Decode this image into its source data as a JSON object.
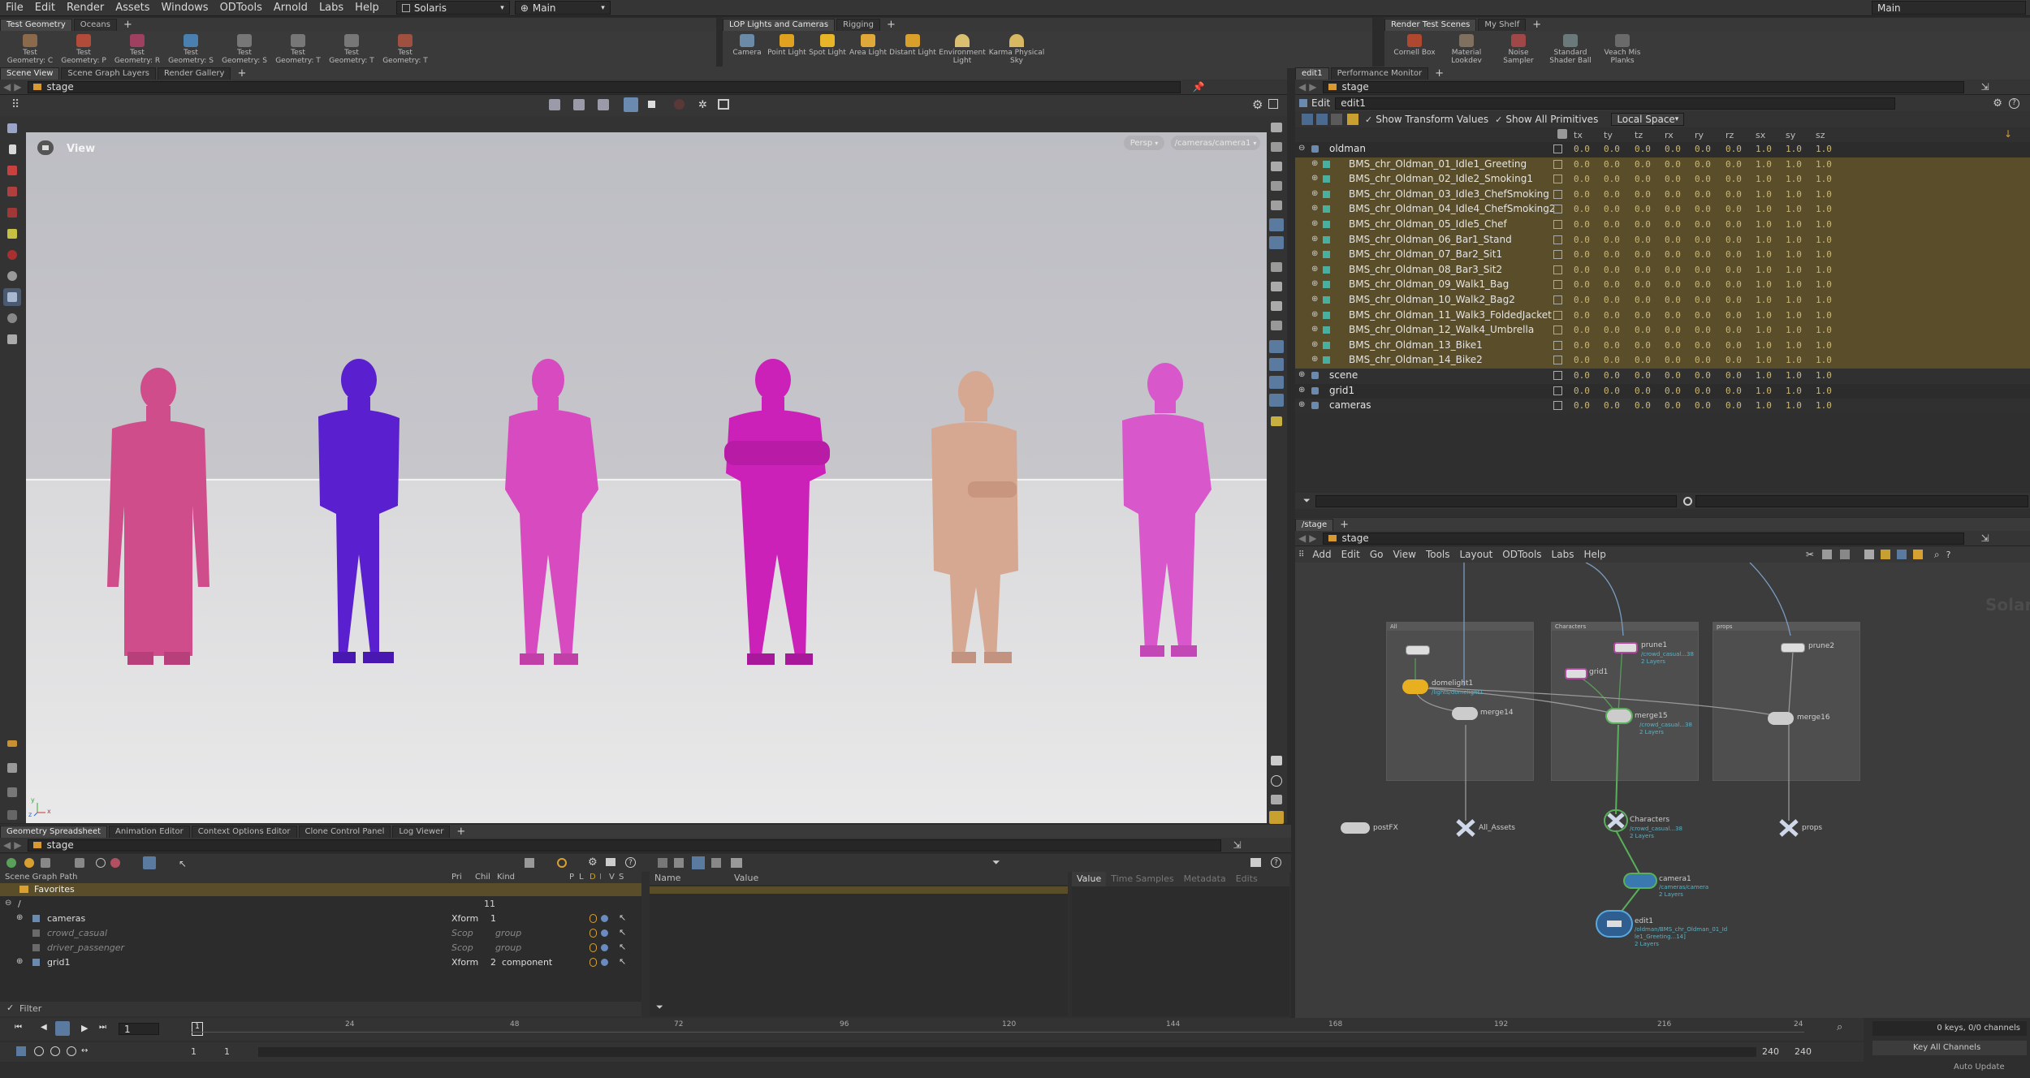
{
  "menu": [
    "File",
    "Edit",
    "Render",
    "Assets",
    "Windows",
    "ODTools",
    "Arnold",
    "Labs",
    "Help"
  ],
  "desktop": "Solaris",
  "main_dropdown": "Main",
  "top_right_dropdown": "Main",
  "shelf_left": {
    "tabs": [
      "Test Geometry",
      "Oceans"
    ],
    "tools": [
      "Test Geometry: C",
      "Test Geometry: P",
      "Test Geometry: R",
      "Test Geometry: S",
      "Test Geometry: S",
      "Test Geometry: T",
      "Test Geometry: T",
      "Test Geometry: T"
    ]
  },
  "shelf_mid": {
    "tabs": [
      "LOP Lights and Cameras",
      "Rigging"
    ],
    "tools": [
      "Camera",
      "Point Light",
      "Spot Light",
      "Area Light",
      "Distant Light",
      "Environment Light",
      "Karma Physical Sky"
    ]
  },
  "shelf_right": {
    "tabs": [
      "Render Test Scenes",
      "My Shelf"
    ],
    "tools": [
      "Cornell Box",
      "Material Lookdev",
      "Noise Sampler",
      "Standard Shader Ball",
      "Veach Mis Planks"
    ]
  },
  "viewport": {
    "tabs": [
      "Scene View",
      "Scene Graph Layers",
      "Render Gallery"
    ],
    "path": "stage",
    "label": "View",
    "persp": "Persp",
    "camera": "/cameras/camera1",
    "axis_labels": [
      "y",
      "z",
      "x"
    ],
    "figures": [
      "#cf4d8a",
      "#5a1fcf",
      "#d84bc0",
      "#cc21b8",
      "#d7a891",
      "#d858cc"
    ]
  },
  "edit_pane": {
    "tabs": [
      "edit1",
      "Performance Monitor"
    ],
    "path": "stage",
    "edit_label": "Edit",
    "node_name": "edit1",
    "show_transform": "Show Transform Values",
    "show_all": "Show All Primitives",
    "space": "Local Space",
    "columns": [
      "tx",
      "ty",
      "tz",
      "rx",
      "ry",
      "rz",
      "sx",
      "sy",
      "sz"
    ],
    "rows": [
      {
        "name": "oldman",
        "level": 0,
        "expander": "⊖",
        "values": [
          "0.0",
          "0.0",
          "0.0",
          "0.0",
          "0.0",
          "0.0",
          "1.0",
          "1.0",
          "1.0"
        ],
        "hl": false
      },
      {
        "name": "BMS_chr_Oldman_01_Idle1_Greeting",
        "level": 1,
        "expander": "⊕",
        "values": [
          "0.0",
          "0.0",
          "0.0",
          "0.0",
          "0.0",
          "0.0",
          "1.0",
          "1.0",
          "1.0"
        ],
        "hl": true
      },
      {
        "name": "BMS_chr_Oldman_02_Idle2_Smoking1",
        "level": 1,
        "expander": "⊕",
        "values": [
          "0.0",
          "0.0",
          "0.0",
          "0.0",
          "0.0",
          "0.0",
          "1.0",
          "1.0",
          "1.0"
        ],
        "hl": true
      },
      {
        "name": "BMS_chr_Oldman_03_Idle3_ChefSmoking",
        "level": 1,
        "expander": "⊕",
        "values": [
          "0.0",
          "0.0",
          "0.0",
          "0.0",
          "0.0",
          "0.0",
          "1.0",
          "1.0",
          "1.0"
        ],
        "hl": true
      },
      {
        "name": "BMS_chr_Oldman_04_Idle4_ChefSmoking2",
        "level": 1,
        "expander": "⊕",
        "values": [
          "0.0",
          "0.0",
          "0.0",
          "0.0",
          "0.0",
          "0.0",
          "1.0",
          "1.0",
          "1.0"
        ],
        "hl": true
      },
      {
        "name": "BMS_chr_Oldman_05_Idle5_Chef",
        "level": 1,
        "expander": "⊕",
        "values": [
          "0.0",
          "0.0",
          "0.0",
          "0.0",
          "0.0",
          "0.0",
          "1.0",
          "1.0",
          "1.0"
        ],
        "hl": true
      },
      {
        "name": "BMS_chr_Oldman_06_Bar1_Stand",
        "level": 1,
        "expander": "⊕",
        "values": [
          "0.0",
          "0.0",
          "0.0",
          "0.0",
          "0.0",
          "0.0",
          "1.0",
          "1.0",
          "1.0"
        ],
        "hl": true
      },
      {
        "name": "BMS_chr_Oldman_07_Bar2_Sit1",
        "level": 1,
        "expander": "⊕",
        "values": [
          "0.0",
          "0.0",
          "0.0",
          "0.0",
          "0.0",
          "0.0",
          "1.0",
          "1.0",
          "1.0"
        ],
        "hl": true
      },
      {
        "name": "BMS_chr_Oldman_08_Bar3_Sit2",
        "level": 1,
        "expander": "⊕",
        "values": [
          "0.0",
          "0.0",
          "0.0",
          "0.0",
          "0.0",
          "0.0",
          "1.0",
          "1.0",
          "1.0"
        ],
        "hl": true
      },
      {
        "name": "BMS_chr_Oldman_09_Walk1_Bag",
        "level": 1,
        "expander": "⊕",
        "values": [
          "0.0",
          "0.0",
          "0.0",
          "0.0",
          "0.0",
          "0.0",
          "1.0",
          "1.0",
          "1.0"
        ],
        "hl": true
      },
      {
        "name": "BMS_chr_Oldman_10_Walk2_Bag2",
        "level": 1,
        "expander": "⊕",
        "values": [
          "0.0",
          "0.0",
          "0.0",
          "0.0",
          "0.0",
          "0.0",
          "1.0",
          "1.0",
          "1.0"
        ],
        "hl": true
      },
      {
        "name": "BMS_chr_Oldman_11_Walk3_FoldedJacket",
        "level": 1,
        "expander": "⊕",
        "values": [
          "0.0",
          "0.0",
          "0.0",
          "0.0",
          "0.0",
          "0.0",
          "1.0",
          "1.0",
          "1.0"
        ],
        "hl": true
      },
      {
        "name": "BMS_chr_Oldman_12_Walk4_Umbrella",
        "level": 1,
        "expander": "⊕",
        "values": [
          "0.0",
          "0.0",
          "0.0",
          "0.0",
          "0.0",
          "0.0",
          "1.0",
          "1.0",
          "1.0"
        ],
        "hl": true
      },
      {
        "name": "BMS_chr_Oldman_13_Bike1",
        "level": 1,
        "expander": "⊕",
        "values": [
          "0.0",
          "0.0",
          "0.0",
          "0.0",
          "0.0",
          "0.0",
          "1.0",
          "1.0",
          "1.0"
        ],
        "hl": true
      },
      {
        "name": "BMS_chr_Oldman_14_Bike2",
        "level": 1,
        "expander": "⊕",
        "values": [
          "0.0",
          "0.0",
          "0.0",
          "0.0",
          "0.0",
          "0.0",
          "1.0",
          "1.0",
          "1.0"
        ],
        "hl": true
      },
      {
        "name": "scene",
        "level": 0,
        "expander": "⊕",
        "values": [
          "0.0",
          "0.0",
          "0.0",
          "0.0",
          "0.0",
          "0.0",
          "1.0",
          "1.0",
          "1.0"
        ],
        "hl": false
      },
      {
        "name": "grid1",
        "level": 0,
        "expander": "⊕",
        "values": [
          "0.0",
          "0.0",
          "0.0",
          "0.0",
          "0.0",
          "0.0",
          "1.0",
          "1.0",
          "1.0"
        ],
        "hl": false
      },
      {
        "name": "cameras",
        "level": 0,
        "expander": "⊕",
        "values": [
          "0.0",
          "0.0",
          "0.0",
          "0.0",
          "0.0",
          "0.0",
          "1.0",
          "1.0",
          "1.0"
        ],
        "hl": false
      }
    ]
  },
  "network": {
    "tab": "/stage",
    "path": "stage",
    "menus": [
      "Add",
      "Edit",
      "Go",
      "View",
      "Tools",
      "Layout",
      "ODTools",
      "Labs",
      "Help"
    ],
    "context": "Solaris",
    "boxes": [
      "All",
      "Characters",
      "props"
    ],
    "nodes": [
      {
        "label": "domelight1",
        "sub": "/lights/domelight1"
      },
      {
        "label": "merge14",
        "sub": ""
      },
      {
        "label": "prune1",
        "sub": "/crowd_casual...38",
        "sub2": "2 Layers"
      },
      {
        "label": "grid1",
        "sub": ""
      },
      {
        "label": "merge15",
        "sub": "/crowd_casual...38",
        "sub2": "2 Layers"
      },
      {
        "label": "prune2",
        "sub": ""
      },
      {
        "label": "merge16",
        "sub": ""
      },
      {
        "label": "postFX",
        "sub": ""
      },
      {
        "label": "All_Assets",
        "sub": ""
      },
      {
        "label": "Characters",
        "sub": "/crowd_casual...38",
        "sub2": "2 Layers"
      },
      {
        "label": "props",
        "sub": ""
      },
      {
        "label": "camera1",
        "sub": "/cameras/camera",
        "sub2": "2 Layers"
      },
      {
        "label": "edit1",
        "sub": "/oldman/BMS_chr_Oldman_01_Id",
        "sub1": "le1_Greeting...14]",
        "sub2": "2 Layers"
      }
    ]
  },
  "spreadsheet": {
    "tabs": [
      "Geometry Spreadsheet",
      "Animation Editor",
      "Context Options Editor",
      "Clone Control Panel",
      "Log Viewer"
    ],
    "path": "stage",
    "headers": [
      "Scene Graph Path",
      "Pri",
      "Chil",
      "Kind",
      "P",
      "L",
      "D",
      "I",
      "V",
      "S"
    ],
    "favorites": "Favorites",
    "root_path": "/",
    "root_count": "11",
    "rows": [
      {
        "path": "cameras",
        "pri": "Xform",
        "chil": "1",
        "kind": "",
        "italic": false
      },
      {
        "path": "crowd_casual",
        "pri": "Scop",
        "chil": "",
        "kind": "group",
        "italic": true
      },
      {
        "path": "driver_passenger",
        "pri": "Scop",
        "chil": "",
        "kind": "group",
        "italic": true
      },
      {
        "path": "grid1",
        "pri": "Xform",
        "chil": "2",
        "kind": "component",
        "italic": false
      }
    ],
    "filter": "Filter",
    "name_col": "Name",
    "value_col": "Value",
    "right_tabs": [
      "Value",
      "Time Samples",
      "Metadata",
      "Edits"
    ]
  },
  "timeline": {
    "frame": "1",
    "ticks": [
      "24",
      "48",
      "72",
      "96",
      "120",
      "144",
      "168",
      "192",
      "216",
      "24"
    ],
    "start": "1",
    "start2": "1",
    "end": "240",
    "end2": "240",
    "keys": "0 keys, 0/0 channels",
    "key_all": "Key All Channels",
    "auto_update": "Auto Update"
  }
}
